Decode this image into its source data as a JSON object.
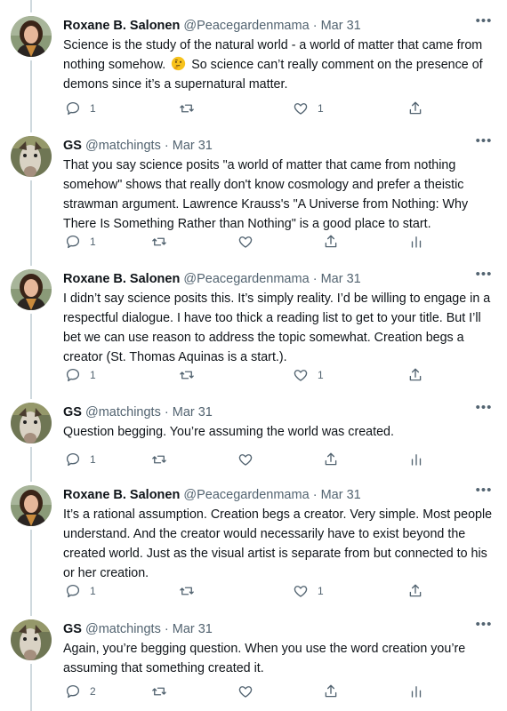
{
  "tweets": [
    {
      "name": "Roxane B. Salonen",
      "handle": "@Peacegardenmama",
      "date": "Mar 31",
      "text_a": "Science is the study of the natural world - a world of matter that came from nothing somehow.",
      "emoji": "thinking-face-emoji",
      "text_b": " So science can’t really comment on the presence of demons since it’s a supernatural matter.",
      "replies": "1",
      "retweets": "",
      "likes": "1"
    },
    {
      "name": "GS",
      "handle": "@matchingts",
      "date": "Mar 31",
      "text": "That you say science posits \"a world of matter that came from nothing somehow\" shows that really don't know cosmology and prefer a theistic strawman argument. Lawrence Krauss's \"A Universe from Nothing: Why There Is Something Rather than Nothing\" is a good place to start.",
      "replies": "1",
      "retweets": "",
      "likes": ""
    },
    {
      "name": "Roxane B. Salonen",
      "handle": "@Peacegardenmama",
      "date": "Mar 31",
      "text": "I didn’t say science posits this. It’s simply reality. I’d be willing to engage in a respectful dialogue. I have too thick a reading list to get to your title. But I’ll bet we can use reason to address the topic somewhat. Creation begs a creator (St. Thomas Aquinas is a start.).",
      "replies": "1",
      "retweets": "",
      "likes": "1"
    },
    {
      "name": "GS",
      "handle": "@matchingts",
      "date": "Mar 31",
      "text": "Question begging. You’re assuming the world was created.",
      "replies": "1",
      "retweets": "",
      "likes": ""
    },
    {
      "name": "Roxane B. Salonen",
      "handle": "@Peacegardenmama",
      "date": "Mar 31",
      "text": "It’s a rational assumption. Creation begs a creator. Very simple. Most people understand. And the creator would necessarily have to exist beyond the created world. Just as the visual artist is separate from but connected to his or her creation.",
      "replies": "1",
      "retweets": "",
      "likes": "1"
    },
    {
      "name": "GS",
      "handle": "@matchingts",
      "date": "Mar 31",
      "text": "Again, you’re begging question. When you use the word creation you’re assuming that something created it.",
      "replies": "2",
      "retweets": "",
      "likes": ""
    }
  ],
  "ui": {
    "dot": "·",
    "more": "•••"
  },
  "icons": {
    "reply": "reply-icon",
    "retweet": "retweet-icon",
    "like": "heart-icon",
    "share": "share-icon",
    "analytics": "analytics-icon"
  },
  "colors": {
    "text": "#0f1419",
    "secondary": "#536471",
    "thread_line": "#cfd9de"
  }
}
